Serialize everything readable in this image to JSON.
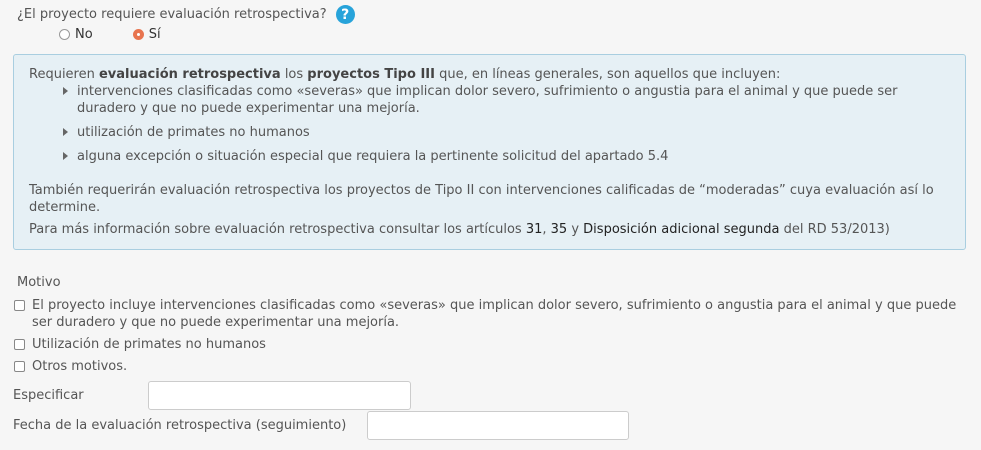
{
  "question": {
    "text": "¿El proyecto requiere evaluación retrospectiva?",
    "help_icon_glyph": "?",
    "options": [
      {
        "label": "No",
        "checked": false
      },
      {
        "label": "Sí",
        "checked": true
      }
    ]
  },
  "info": {
    "p1_a": "Requieren ",
    "p1_b": "evaluación retrospectiva",
    "p1_c": " los ",
    "p1_d": "proyectos Tipo III",
    "p1_e": " que, en líneas generales, son aquellos que incluyen:",
    "items": [
      "intervenciones clasificadas como «severas» que implican dolor severo, sufrimiento o angustia para el animal y que puede ser duradero y que no puede experimentar una mejoría.",
      "utilización de primates no humanos",
      "alguna excepción o situación especial que requiera la pertinente solicitud del apartado 5.4"
    ],
    "p2": "También requerirán evaluación retrospectiva los proyectos de Tipo II con intervenciones calificadas de “moderadas” cuya evaluación así lo determine.",
    "p3_a": "Para más información sobre evaluación retrospectiva consultar los artículos ",
    "link_31": "31",
    "p3_sep": ", ",
    "link_35": "35",
    "p3_y": " y ",
    "link_disp": "Disposición adicional segunda",
    "p3_end": " del RD 53/2013)"
  },
  "motivo": {
    "title": "Motivo",
    "checks": [
      "El proyecto incluye intervenciones clasificadas como «severas» que implican dolor severo, sufrimiento o angustia para el animal y que puede ser duradero y que no puede experimentar una mejoría.",
      "Utilización de primates no humanos",
      "Otros motivos."
    ]
  },
  "fields": {
    "especificar_label": "Especificar",
    "especificar_value": "",
    "fecha_label": "Fecha de la evaluación retrospectiva (seguimiento)",
    "fecha_value": ""
  }
}
